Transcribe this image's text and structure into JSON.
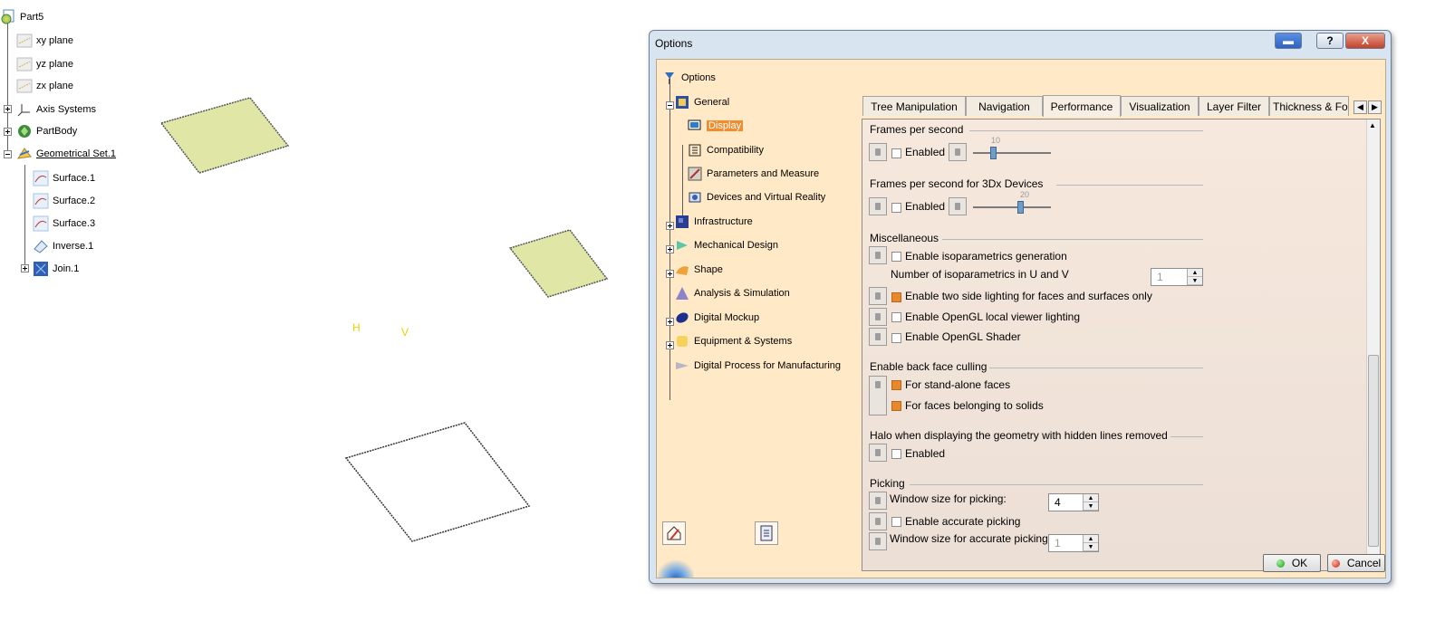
{
  "spec_tree": {
    "root": "Part5",
    "items": [
      "xy plane",
      "yz plane",
      "zx plane",
      "Axis Systems",
      "PartBody",
      "Geometrical Set.1"
    ],
    "children": [
      "Surface.1",
      "Surface.2",
      "Surface.3",
      "Inverse.1",
      "Join.1"
    ]
  },
  "viewport": {
    "compass_h": "H",
    "compass_v": "V"
  },
  "dialog": {
    "title": "Options",
    "help_label": "?",
    "close_label": "X",
    "tree": {
      "root": "Options",
      "general": "General",
      "general_children": [
        "Display",
        "Compatibility",
        "Parameters and Measure",
        "Devices and Virtual Reality"
      ],
      "others": [
        "Infrastructure",
        "Mechanical Design",
        "Shape",
        "Analysis & Simulation",
        "Digital Mockup",
        "Equipment & Systems",
        "Digital Process for Manufacturing"
      ]
    },
    "tabs": [
      "Tree Manipulation",
      "Navigation",
      "Performance",
      "Visualization",
      "Layer Filter",
      "Thickness & Fo"
    ],
    "active_tab": "Performance",
    "sections": {
      "fps": {
        "title": "Frames per second",
        "enabled": "Enabled",
        "slider_value": "10",
        "slider_level": 0.25
      },
      "fps3d": {
        "title": "Frames per second for 3Dx Devices",
        "enabled": "Enabled",
        "slider_value": "20",
        "slider_level": 0.6
      },
      "misc": {
        "title": "Miscellaneous",
        "isoparam": "Enable isoparametrics generation",
        "num_iso": "Number of isoparametrics in U and V",
        "num_iso_value": "1",
        "two_side": "Enable two side lighting for faces and surfaces only",
        "local_viewer": "Enable OpenGL local viewer lighting",
        "shader": "Enable OpenGL Shader"
      },
      "culling": {
        "title": "Enable back face culling",
        "standalone": "For stand-alone faces",
        "solids": "For faces belonging to solids"
      },
      "halo": {
        "title": "Halo when displaying the geometry with hidden lines removed",
        "enabled": "Enabled"
      },
      "picking": {
        "title": "Picking",
        "window_size": "Window size for picking:",
        "window_size_value": "4",
        "accurate": "Enable accurate picking",
        "accurate_size": "Window size for accurate picking:",
        "accurate_size_value": "1"
      }
    },
    "ok": "OK",
    "cancel": "Cancel",
    "colors": {
      "selection": "#f08d2e",
      "panel": "#ffe9c6"
    }
  }
}
